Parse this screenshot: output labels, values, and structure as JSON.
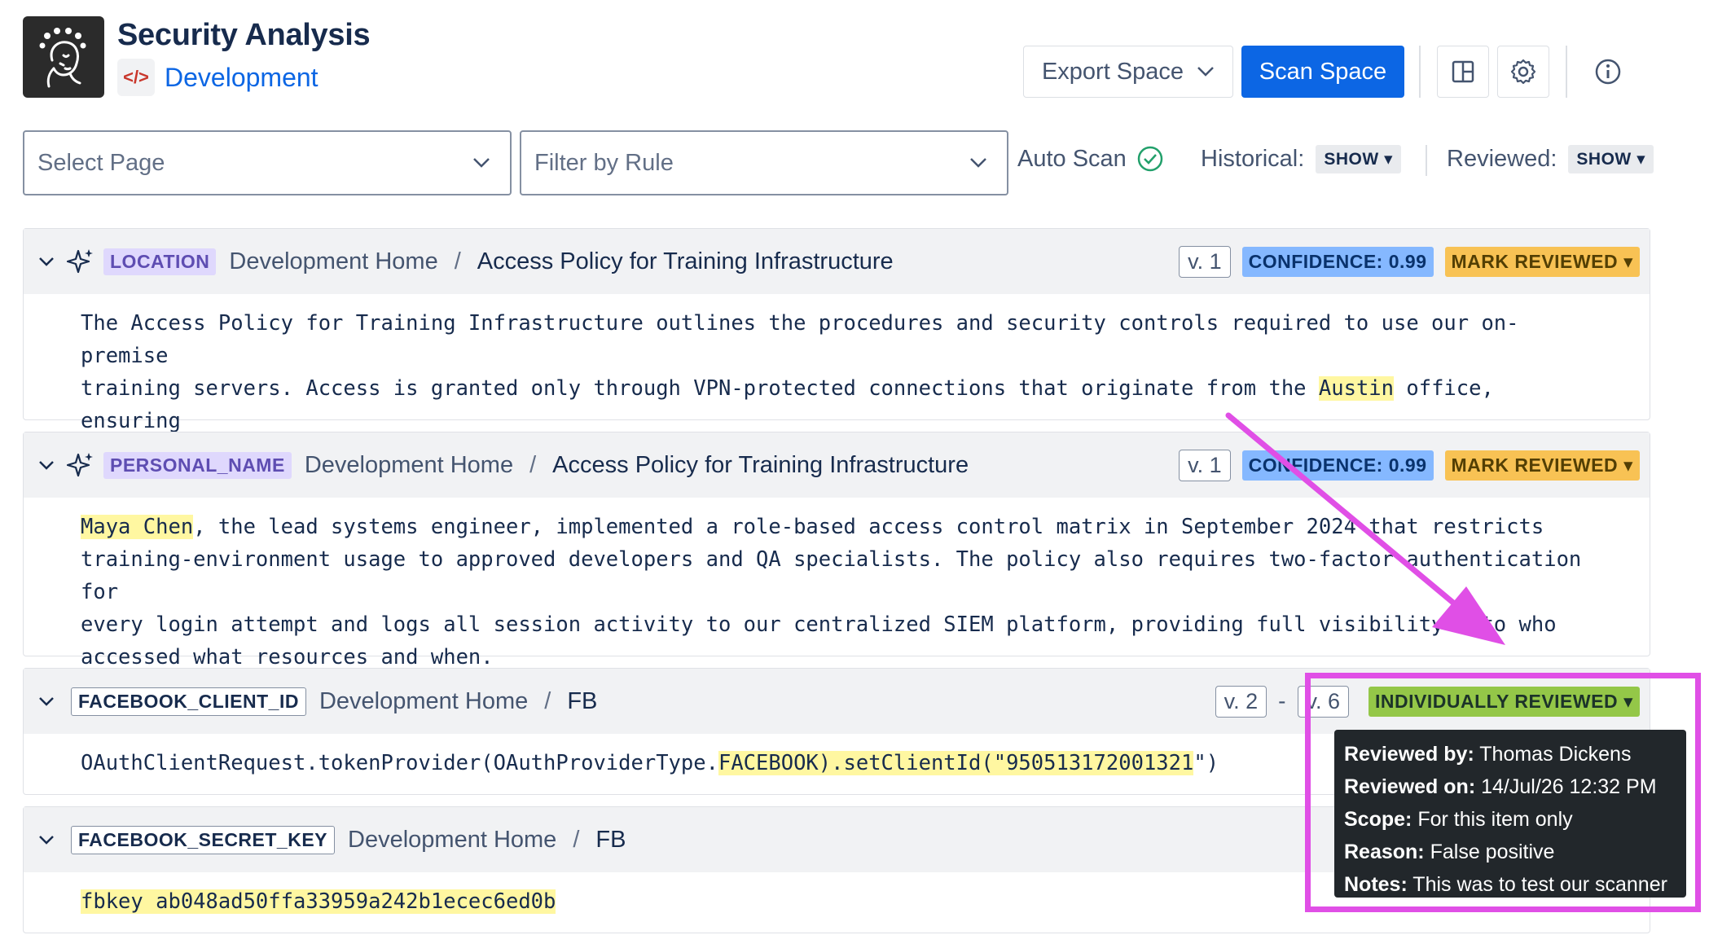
{
  "header": {
    "title": "Security Analysis",
    "space_icon_glyph": "</>",
    "space_name": "Development",
    "export_label": "Export Space",
    "scan_label": "Scan Space"
  },
  "filters": {
    "page_placeholder": "Select Page",
    "rule_placeholder": "Filter by Rule",
    "auto_scan_label": "Auto Scan",
    "historical_label": "Historical:",
    "historical_value": "SHOW",
    "reviewed_label": "Reviewed:",
    "reviewed_value": "SHOW"
  },
  "findings": [
    {
      "type": "LOCATION",
      "crumb_root": "Development Home",
      "sep": "/",
      "page": "Access Policy for Training Infrastructure",
      "version": "v. 1",
      "confidence": "CONFIDENCE: 0.99",
      "action": "MARK REVIEWED ▾",
      "text_a": "The Access Policy for Training Infrastructure outlines the procedures and security controls required to use our on-premise\ntraining servers. Access is granted only through VPN-protected connections that originate from the ",
      "match": "Austin",
      "text_b": " office, ensuring\nthat all activity can be monitored and audited within a single, secure network perimeter."
    },
    {
      "type": "PERSONAL_NAME",
      "crumb_root": "Development Home",
      "sep": "/",
      "page": "Access Policy for Training Infrastructure",
      "version": "v. 1",
      "confidence": "CONFIDENCE: 0.99",
      "action": "MARK REVIEWED ▾",
      "text_a": "",
      "match": "Maya Chen",
      "text_b": ", the lead systems engineer, implemented a role-based access control matrix in September 2024 that restricts\ntraining-environment usage to approved developers and QA specialists. The policy also requires two-factor authentication for\nevery login attempt and logs all session activity to our centralized SIEM platform, providing full visibility into who\naccessed what resources and when."
    },
    {
      "type": "FACEBOOK_CLIENT_ID",
      "crumb_root": "Development Home",
      "sep": "/",
      "page": "FB",
      "version_from": "v. 2",
      "version_dash": "-",
      "version_to": "v. 6",
      "status": "INDIVIDUALLY REVIEWED ▾",
      "text_a": "OAuthClientRequest.tokenProvider(OAuthProviderType.",
      "match": "FACEBOOK).setClientId(\"950513172001321",
      "text_b": "\")"
    },
    {
      "type": "FACEBOOK_SECRET_KEY",
      "crumb_root": "Development Home",
      "sep": "/",
      "page": "FB",
      "text_a": "",
      "match": "fbkey ab048ad50ffa33959a242b1ecec6ed0b",
      "text_b": ""
    }
  ],
  "tooltip": {
    "reviewed_by_label": "Reviewed by:",
    "reviewed_by": "Thomas Dickens",
    "reviewed_on_label": "Reviewed on:",
    "reviewed_on": "14/Jul/26 12:32 PM",
    "scope_label": "Scope:",
    "scope": "For this item only",
    "reason_label": "Reason:",
    "reason": "False positive",
    "notes_label": "Notes:",
    "notes": "This was to test our scanner"
  },
  "colors": {
    "primary": "#0c66e4",
    "annotation": "#e04fe6",
    "highlight": "#fff7a1",
    "confidence": "#85b8ff",
    "mark_reviewed": "#f8c254",
    "individually_reviewed": "#94c748"
  }
}
